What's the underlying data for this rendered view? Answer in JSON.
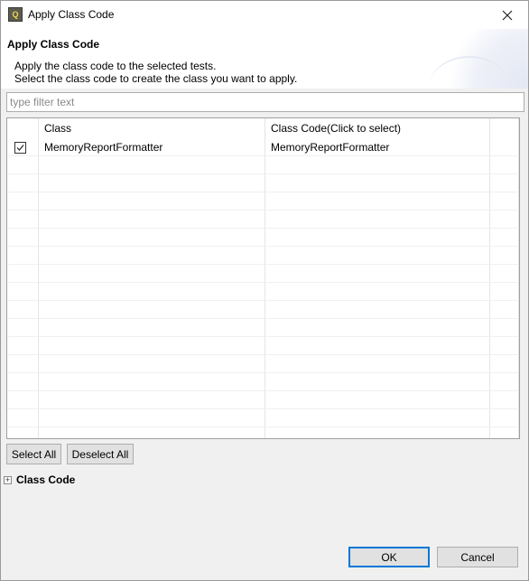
{
  "window": {
    "title": "Apply Class Code",
    "app_icon_text": "Q"
  },
  "header": {
    "title": "Apply Class Code",
    "description_line1": "Apply the class code to the selected tests.",
    "description_line2": "Select the class code to create the class you want to apply."
  },
  "filter": {
    "placeholder": "type filter text",
    "value": ""
  },
  "table": {
    "columns": [
      "",
      "Class",
      "Class Code(Click to select)",
      ""
    ],
    "rows": [
      {
        "checked": true,
        "class": "MemoryReportFormatter",
        "class_code": "MemoryReportFormatter"
      }
    ]
  },
  "actions": {
    "select_all": "Select All",
    "deselect_all": "Deselect All"
  },
  "section": {
    "label": "Class Code",
    "expander_glyph": "+"
  },
  "footer": {
    "ok": "OK",
    "cancel": "Cancel"
  },
  "icons": {
    "close": "close-icon",
    "checkbox": "checkbox-checked-icon",
    "expand": "plus-icon"
  },
  "colors": {
    "focus_border": "#0078d7",
    "dialog_bg": "#f0f0f0"
  }
}
